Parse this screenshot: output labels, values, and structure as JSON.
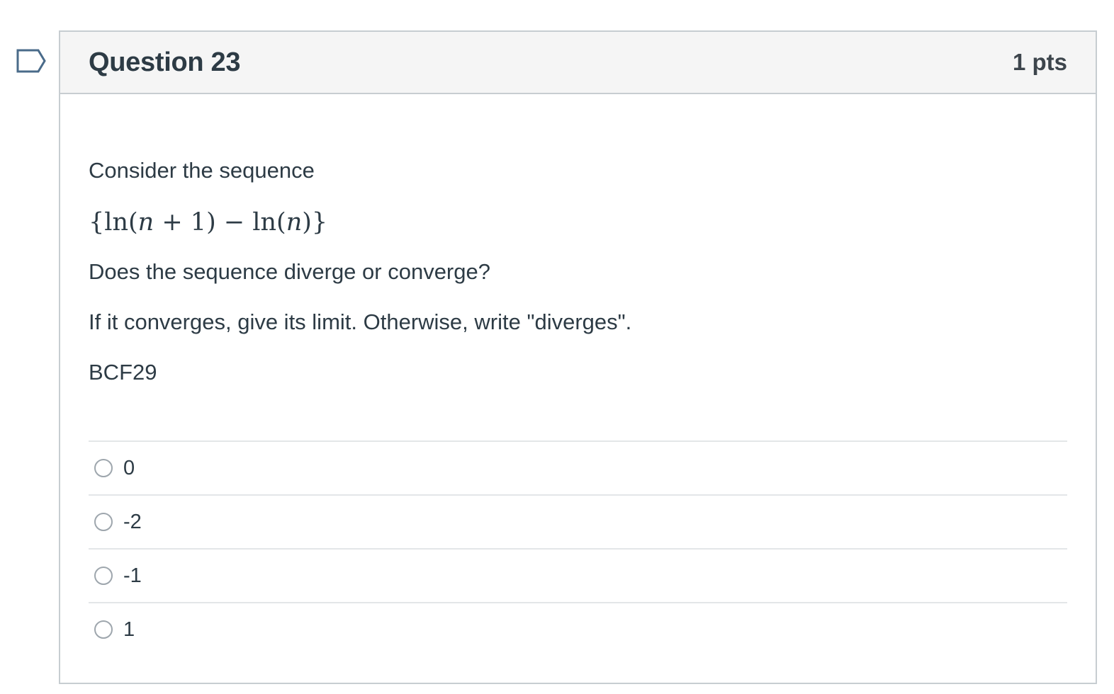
{
  "question": {
    "title": "Question 23",
    "points": "1 pts",
    "intro": "Consider the sequence",
    "formula": {
      "open": "{ln(",
      "n1": "n",
      "mid": " + 1) − ln(",
      "n2": "n",
      "close": ")}"
    },
    "line2": "Does the sequence diverge or converge?",
    "line3": "If it converges, give its limit. Otherwise, write \"diverges\".",
    "code": "BCF29"
  },
  "answers": [
    {
      "label": "0",
      "selected": false
    },
    {
      "label": "-2",
      "selected": false
    },
    {
      "label": "-1",
      "selected": false
    },
    {
      "label": "1",
      "selected": false
    }
  ],
  "icons": {
    "flag": "flag-outline-icon"
  },
  "colors": {
    "text": "#2d3b45",
    "header_bg": "#f5f5f5",
    "border": "#c7cdd1",
    "flag": "#4a6b8a"
  }
}
